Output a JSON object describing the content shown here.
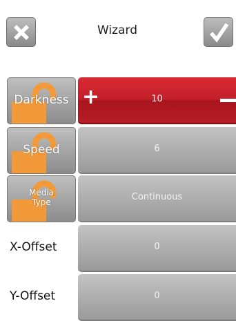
{
  "header": {
    "title": "Wizard",
    "cancel_icon": "close-icon",
    "confirm_icon": "checkmark-icon"
  },
  "settings": [
    {
      "label": "Darkness",
      "value": "10",
      "locked": true,
      "active": true,
      "plus": "+"
    },
    {
      "label": "Speed",
      "value": "6",
      "locked": true
    },
    {
      "label_line1": "Media",
      "label_line2": "Type",
      "value": "Continuous",
      "locked": true
    },
    {
      "label": "X-Offset",
      "value": "0"
    },
    {
      "label": "Y-Offset",
      "value": "0"
    }
  ],
  "colors": {
    "active": "#c3202a",
    "lock": "#f29a3a",
    "tile": "#a6a6a6"
  }
}
